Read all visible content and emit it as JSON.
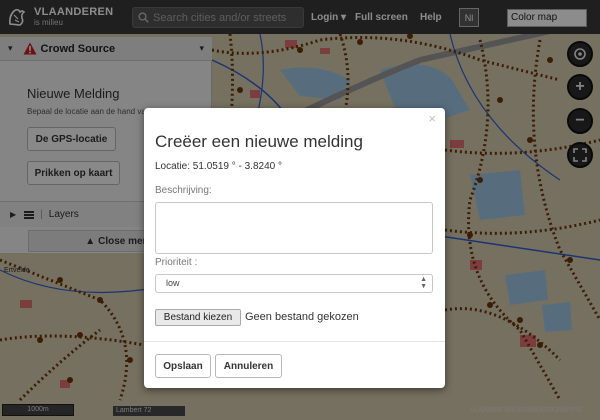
{
  "header": {
    "logo_title": "VLAANDEREN",
    "logo_sub": "is milieu",
    "search_placeholder": "Search cities and/or streets",
    "login_label": "Login",
    "fullscreen_label": "Full screen",
    "help_label": "Help",
    "language_label": "Nl",
    "colormap_value": "Color map"
  },
  "panel": {
    "title": "Crowd Source",
    "heading": "Nieuwe Melding",
    "description": "Bepaal de locatie aan de hand van",
    "gps_button": "De GPS-locatie",
    "map_button": "Prikken op kaart",
    "layers_label": "Layers",
    "close_label": "Close menu"
  },
  "dialog": {
    "title": "Creëer een nieuwe melding",
    "location": "Locatie: 51.0519 ° - 3.8240 °",
    "description_label": "Beschrijving:",
    "description_value": "",
    "priority_label": "Prioriteit :",
    "priority_value": "low",
    "file_button": "Bestand kiezen",
    "file_status": "Geen bestand gekozen",
    "save_button": "Opslaan",
    "cancel_button": "Annuleren"
  },
  "map": {
    "place_label": "Ertvelde",
    "scale_label": "1000m",
    "projection_label": "Lambert 72",
    "copyright": "VLAAMSE MILIEUMAATSCHAPPIJ"
  },
  "colors": {
    "topbar": "#3a3a3a",
    "map_background": "#d8ccb0",
    "road_dots": "#6b3608",
    "warning": "#cc1f1f"
  }
}
